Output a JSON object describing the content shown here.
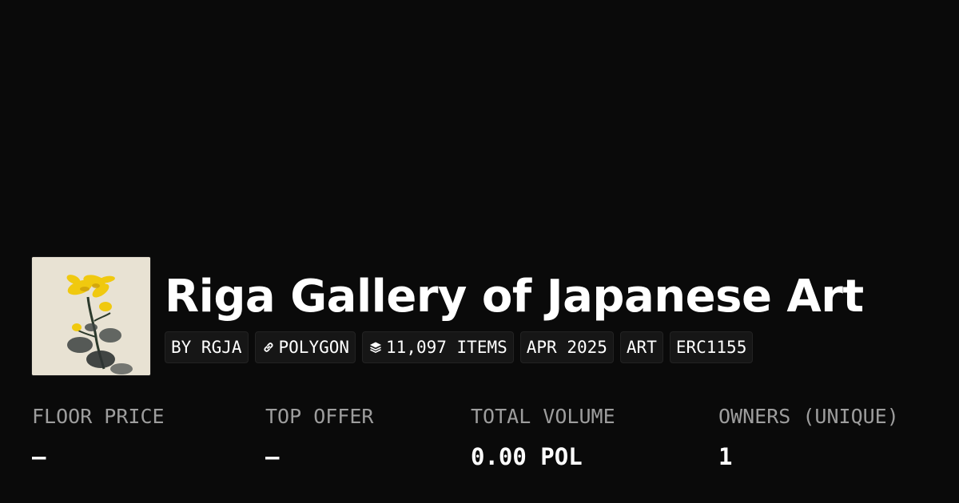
{
  "collection": {
    "title": "Riga Gallery of Japanese Art",
    "tags": {
      "creator": "BY RGJA",
      "chain": "POLYGON",
      "items": "11,097 ITEMS",
      "date": "APR 2025",
      "category": "ART",
      "standard": "ERC1155"
    },
    "icons": {
      "chain": "link-icon",
      "items": "layers-icon"
    }
  },
  "stats": {
    "floor_price": {
      "label": "FLOOR PRICE",
      "value": "–"
    },
    "top_offer": {
      "label": "TOP OFFER",
      "value": "–"
    },
    "total_volume": {
      "label": "TOTAL VOLUME",
      "value": "0.00 POL"
    },
    "owners": {
      "label": "OWNERS (UNIQUE)",
      "value": "1"
    }
  },
  "colors": {
    "background": "#0a0a0a",
    "text": "#ffffff",
    "muted": "#9d9d9d",
    "tag_background": "#161616"
  }
}
